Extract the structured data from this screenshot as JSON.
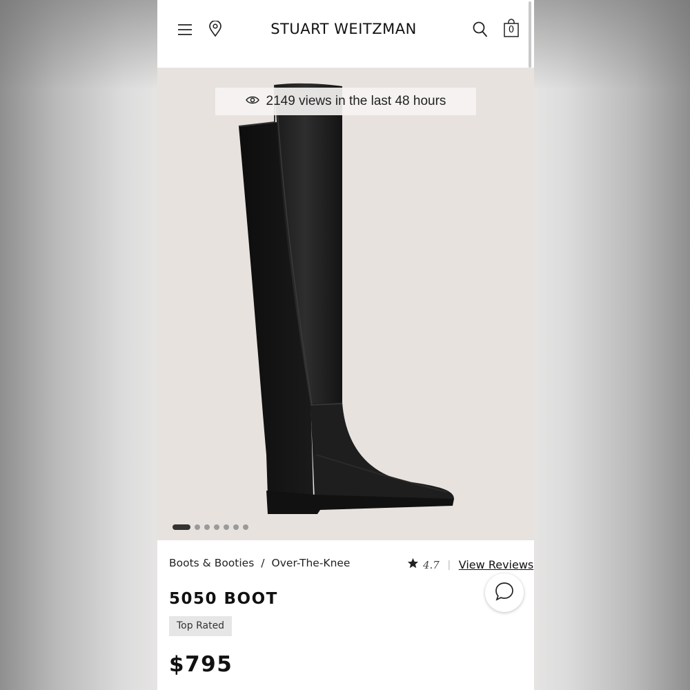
{
  "header": {
    "brand": "STUART WEITZMAN",
    "cart_count": "0",
    "icons": {
      "menu": "hamburger-menu-icon",
      "store": "location-pin-icon",
      "search": "search-icon",
      "cart": "shopping-bag-icon"
    }
  },
  "hero": {
    "views_text": "2149 views in the last 48 hours",
    "views_icon": "eye-icon",
    "image": "over-the-knee-black-boot",
    "carousel": {
      "total": 7,
      "active": 1
    }
  },
  "product": {
    "breadcrumb": [
      "Boots & Booties",
      "/",
      "Over-The-Knee"
    ],
    "rating": "4.7",
    "rating_icon": "star-icon",
    "reviews_link": "View Reviews",
    "name": "5050 BOOT",
    "badge": "Top Rated",
    "price": "$795"
  },
  "chat": {
    "icon": "chat-bubble-icon"
  },
  "colors": {
    "hero_bg": "#e8e2df",
    "text": "#111111",
    "badge_bg": "#e6e6e6"
  }
}
